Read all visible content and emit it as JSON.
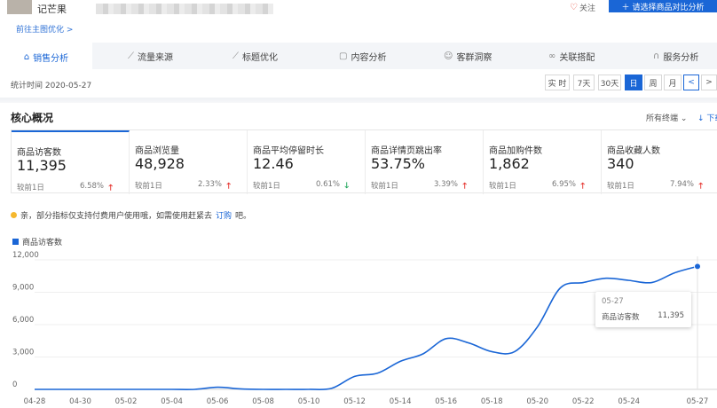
{
  "header": {
    "product_name": "记芒果",
    "follow_label": "关注",
    "compare_button": "请选择商品对比分析",
    "home_link": "前往主图优化 >"
  },
  "tabs": [
    {
      "label": "销售分析",
      "icon": "bag-icon",
      "active": true
    },
    {
      "label": "流量来源",
      "icon": "trend-icon",
      "active": false
    },
    {
      "label": "标题优化",
      "icon": "trend-icon",
      "active": false
    },
    {
      "label": "内容分析",
      "icon": "doc-icon",
      "active": false
    },
    {
      "label": "客群洞察",
      "icon": "user-icon",
      "active": false
    },
    {
      "label": "关联搭配",
      "icon": "link-icon",
      "active": false
    },
    {
      "label": "服务分析",
      "icon": "headset-icon",
      "active": false
    }
  ],
  "stats": {
    "date_label": "统计时间 2020-05-27",
    "ranges": [
      "实 时",
      "7天",
      "30天",
      "日",
      "周",
      "月"
    ],
    "active_range": "日",
    "prev": "<",
    "next": ">"
  },
  "overview": {
    "title": "核心概况",
    "terminal": "所有终端 ⌄",
    "download": "↓ 下载"
  },
  "cards": [
    {
      "label": "商品访客数",
      "value": "11,395",
      "cmp": "较前1日",
      "pct": "6.58%",
      "dir": "up"
    },
    {
      "label": "商品浏览量",
      "value": "48,928",
      "cmp": "较前1日",
      "pct": "2.33%",
      "dir": "up"
    },
    {
      "label": "商品平均停留时长",
      "value": "12.46",
      "cmp": "较前1日",
      "pct": "0.61%",
      "dir": "down"
    },
    {
      "label": "商品详情页跳出率",
      "value": "53.75%",
      "cmp": "较前1日",
      "pct": "3.39%",
      "dir": "up"
    },
    {
      "label": "商品加购件数",
      "value": "1,862",
      "cmp": "较前1日",
      "pct": "6.95%",
      "dir": "up"
    },
    {
      "label": "商品收藏人数",
      "value": "340",
      "cmp": "较前1日",
      "pct": "7.94%",
      "dir": "up"
    }
  ],
  "notice": {
    "text": "亲，部分指标仅支持付费用户使用哦，如需使用赶紧去",
    "link": "订购",
    "suffix": "吧。"
  },
  "colors": {
    "accent": "#1a66d6",
    "up": "#e5322d",
    "down": "#1fa65a"
  },
  "chart_data": {
    "type": "line",
    "series": [
      {
        "name": "商品访客数",
        "color": "#1a66d6"
      }
    ],
    "x": [
      "04-28",
      "04-29",
      "04-30",
      "05-01",
      "05-02",
      "05-03",
      "05-04",
      "05-05",
      "05-06",
      "05-07",
      "05-08",
      "05-09",
      "05-10",
      "05-11",
      "05-12",
      "05-13",
      "05-14",
      "05-15",
      "05-16",
      "05-17",
      "05-18",
      "05-19",
      "05-20",
      "05-21",
      "05-22",
      "05-23",
      "05-24",
      "05-25",
      "05-26",
      "05-27"
    ],
    "values": [
      0,
      0,
      0,
      0,
      0,
      0,
      0,
      0,
      200,
      50,
      0,
      0,
      0,
      100,
      1200,
      1500,
      2600,
      3300,
      4700,
      4300,
      3500,
      3500,
      5800,
      9400,
      9900,
      10300,
      10100,
      9900,
      10800,
      11395
    ],
    "x_tick_labels": [
      "04-28",
      "04-30",
      "05-02",
      "05-04",
      "05-06",
      "05-08",
      "05-10",
      "05-12",
      "05-14",
      "05-16",
      "05-18",
      "05-20",
      "05-22",
      "05-24",
      "05-27"
    ],
    "y_tick_labels": [
      "0",
      "3,000",
      "6,000",
      "9,000",
      "12,000"
    ],
    "ylim": [
      0,
      12000
    ],
    "grid": true,
    "legend": "top-left",
    "tooltip": {
      "date": "05-27",
      "name": "商品访客数",
      "value": "11,395"
    }
  }
}
